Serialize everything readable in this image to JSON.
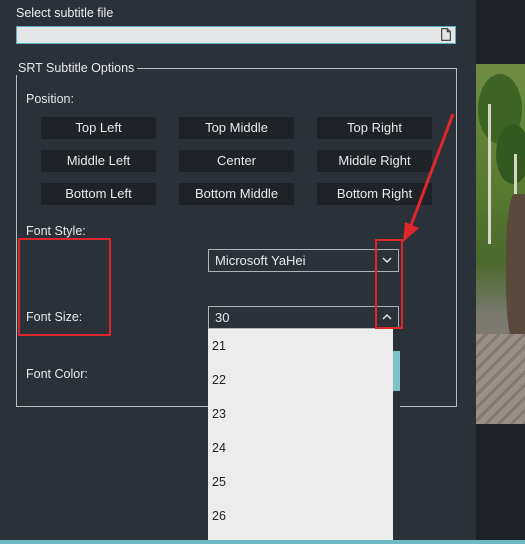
{
  "file": {
    "label": "Select subtitle file",
    "value": "",
    "icon": "file-icon"
  },
  "options": {
    "group_title": "SRT Subtitle Options",
    "position_label": "Position:",
    "positions": [
      "Top Left",
      "Top Middle",
      "Top Right",
      "Middle Left",
      "Center",
      "Middle Right",
      "Bottom Left",
      "Bottom Middle",
      "Bottom Right"
    ],
    "font_style_label": "Font Style:",
    "font_style_value": "Microsoft YaHei",
    "font_size_label": "Font Size:",
    "font_size_value": "30",
    "font_color_label": "Font Color:"
  },
  "dropdown": {
    "options": [
      "21",
      "22",
      "23",
      "24",
      "25",
      "26"
    ]
  },
  "colors": {
    "annotation": "#e0262d",
    "accent": "#6fb9c4"
  }
}
